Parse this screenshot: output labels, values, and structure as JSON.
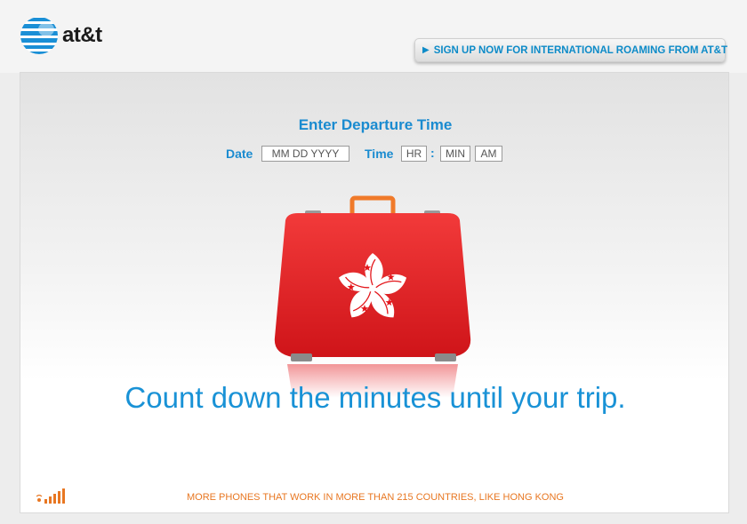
{
  "brand": {
    "logo_text": "at&t"
  },
  "header": {
    "signup_label": "SIGN UP NOW FOR INTERNATIONAL ROAMING FROM AT&T"
  },
  "form": {
    "title": "Enter Departure Time",
    "date_label": "Date",
    "date_placeholder": "MM DD YYYY",
    "time_label": "Time",
    "hour_placeholder": "HR",
    "time_separator": ":",
    "minute_placeholder": "MIN",
    "ampm_placeholder": "AM"
  },
  "tagline": "Count down the minutes until your trip.",
  "footer": {
    "text": "MORE PHONES THAT WORK IN MORE THAN 215 COUNTRIES, LIKE HONG KONG"
  },
  "colors": {
    "accent_blue": "#1a8bd0",
    "brand_orange": "#e87722",
    "flag_red": "#e3161b"
  }
}
